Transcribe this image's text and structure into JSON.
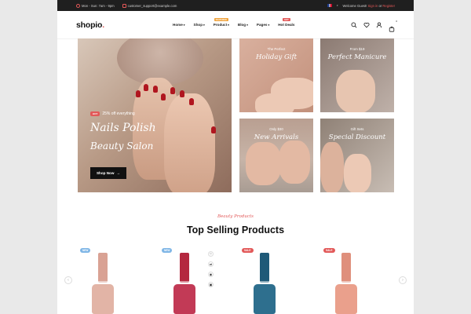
{
  "topbar": {
    "hours": "Mon - Sun: 7am - 9pm",
    "email": "customer_support@example.com",
    "welcome": "Welcome Guest!",
    "sign_in": "Sign in",
    "or": "or",
    "register": "Register"
  },
  "header": {
    "logo": "shopio",
    "logo_dot": ".",
    "nav": [
      {
        "label": "Home",
        "badge": ""
      },
      {
        "label": "Shop",
        "badge": ""
      },
      {
        "label": "Product",
        "badge": "FEATURED"
      },
      {
        "label": "Blog",
        "badge": ""
      },
      {
        "label": "Pages",
        "badge": ""
      },
      {
        "label": "Hot Deals",
        "badge": "HOT"
      }
    ],
    "cart_count": "0",
    "icons": [
      "search-icon",
      "heart-icon",
      "user-icon",
      "cart-icon"
    ]
  },
  "hero": {
    "badge": "HOT",
    "promo": "25% off everything",
    "script_line1": "Nails Polish",
    "script_line2": "Beauty Salon",
    "button": "Shop Now",
    "button_arrow": "→"
  },
  "tiles": [
    {
      "sub": "The Perfect",
      "title": "Holiday Gift"
    },
    {
      "sub": "From $19",
      "title": "Perfect Manicure"
    },
    {
      "sub": "Only $30",
      "title": "New Arrivals"
    },
    {
      "sub": "Gift Sets",
      "title": "Special Discount"
    }
  ],
  "section": {
    "script": "Beauty Products",
    "title": "Top Selling Products"
  },
  "products": [
    {
      "badge": "NEW",
      "badge_color": "#7fb6e6",
      "cap": "#d9a294",
      "body": "#e2b4a6"
    },
    {
      "badge": "NEW",
      "badge_color": "#7fb6e6",
      "cap": "#b4283f",
      "body": "#c23a56"
    },
    {
      "badge": "SALE",
      "badge_color": "#e25858",
      "cap": "#1f5a78",
      "body": "#2e6f8e"
    },
    {
      "badge": "SALE",
      "badge_color": "#e25858",
      "cap": "#df8f7c",
      "body": "#eaa08c"
    }
  ],
  "colors": {
    "accent": "#e25858",
    "dark": "#111111",
    "featured_badge": "#f0a23a"
  }
}
